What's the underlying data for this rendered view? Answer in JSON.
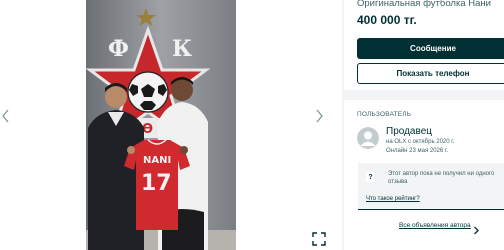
{
  "gallery": {
    "photo": {
      "logo_letters": [
        "Ф",
        "К"
      ],
      "shirt_name": "NANI",
      "shirt_number": "17",
      "sponsor_mark": "Ѳ"
    }
  },
  "ad": {
    "title": "Оригинальная футболка Нани",
    "price": "400 000 тг.",
    "message_button": "Сообщение",
    "phone_button": "Показать телефон"
  },
  "seller": {
    "heading": "ПОЛЬЗОВАТЕЛЬ",
    "name": "Продавец",
    "since": "на OLX с октябрь 2020 г.",
    "online": "Онлайн 23 мая 2026 г.",
    "rating_icon": "?",
    "rating_text": "Этот автор пока не получил ни одного отзыва",
    "rating_link": "Что такое рейтинг?",
    "all_ads": "Все объявления автора"
  },
  "colors": {
    "primary": "#002f34",
    "secondary_text": "#406367",
    "background": "#f2f4f5",
    "stadium_red": "#d4282c"
  },
  "icons": [
    "chevron-left-icon",
    "chevron-right-icon",
    "fullscreen-icon",
    "avatar-icon",
    "question-icon",
    "chevron-right-small-icon"
  ]
}
